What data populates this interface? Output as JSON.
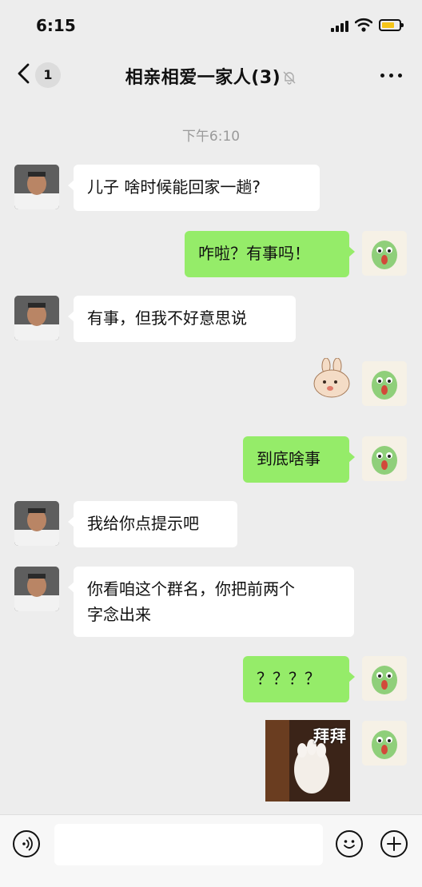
{
  "status_bar": {
    "time": "6:15"
  },
  "nav": {
    "back_badge": "1",
    "title": "相亲相爱一家人(3)"
  },
  "timestamp": "下午6:10",
  "messages": [
    {
      "side": "in",
      "text": "儿子 啥时候能回家一趟?"
    },
    {
      "side": "out",
      "text": "咋啦？有事吗！"
    },
    {
      "side": "in",
      "text": "有事，但我不好意思说"
    },
    {
      "side": "out",
      "type": "sticker",
      "icon": "bunny-sticker"
    },
    {
      "side": "out",
      "text": "到底啥事"
    },
    {
      "side": "in",
      "text": "我给你点提示吧"
    },
    {
      "side": "in",
      "text": "你看咱这个群名，你把前两个\n字念出来"
    },
    {
      "side": "out",
      "text": "？？？？"
    },
    {
      "side": "out",
      "type": "gif",
      "caption": "拜拜"
    }
  ],
  "input_bar": {
    "placeholder": ""
  },
  "icons": {
    "back": "chevron-left-icon",
    "mute": "bell-slash-icon",
    "more": "ellipsis-icon",
    "voice": "voice-icon",
    "emoji": "emoji-icon",
    "plus": "plus-icon"
  },
  "colors": {
    "background": "#ededed",
    "outgoing_bubble": "#95ec69",
    "incoming_bubble": "#ffffff",
    "battery": "#f5c518"
  }
}
